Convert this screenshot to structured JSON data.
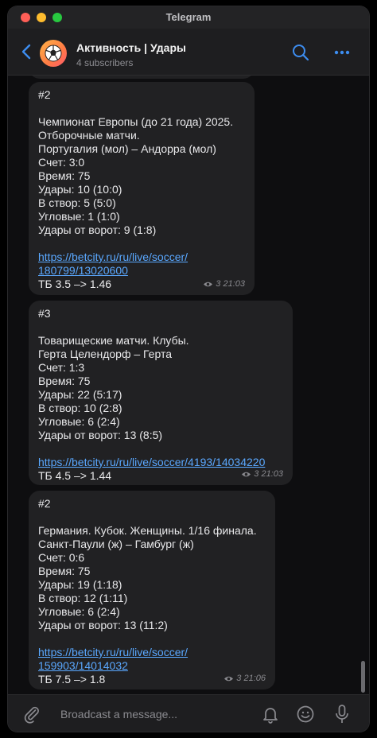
{
  "window": {
    "title": "Telegram"
  },
  "header": {
    "channel_title": "Активность | Удары",
    "subscribers": "4 subscribers",
    "avatar_icon": "soccer-ball-icon"
  },
  "messages": [
    {
      "lines": [
        "#2",
        "",
        "Чемпионат Европы (до 21 года) 2025.",
        "Отборочные матчи.",
        "Португалия (мол) – Андорра (мол)",
        "Счет: 3:0",
        "Время: 75",
        "Удары: 10 (10:0)",
        "В створ: 5 (5:0)",
        "Угловые: 1 (1:0)",
        "Удары от ворот: 9 (1:8)",
        ""
      ],
      "link_lines": [
        "https://betcity.ru/ru/live/soccer/",
        "180799/13020600"
      ],
      "footer": "ТБ 3.5 –> 1.46",
      "time": "3 21:03"
    },
    {
      "lines": [
        "#3",
        "",
        "Товарищеские матчи. Клубы.",
        "Герта Целендорф – Герта",
        "Счет: 1:3",
        "Время: 75",
        "Удары: 22 (5:17)",
        "В створ: 10 (2:8)",
        "Угловые: 6 (2:4)",
        "Удары от ворот: 13 (8:5)",
        ""
      ],
      "link_lines": [
        "https://betcity.ru/ru/live/soccer/4193/14034220"
      ],
      "footer": "ТБ 4.5 –> 1.44",
      "time": "3 21:03"
    },
    {
      "lines": [
        "#2",
        "",
        "Германия. Кубок. Женщины. 1/16 финала.",
        "Санкт-Паули (ж) – Гамбург (ж)",
        "Счет: 0:6",
        "Время: 75",
        "Удары: 19 (1:18)",
        "В створ: 12 (1:11)",
        "Угловые: 6 (2:4)",
        "Удары от ворот: 13 (11:2)",
        ""
      ],
      "link_lines": [
        "https://betcity.ru/ru/live/soccer/",
        "159903/14014032"
      ],
      "footer": "ТБ 7.5 –> 1.8",
      "time": "3 21:06"
    }
  ],
  "composer": {
    "placeholder": "Broadcast a message..."
  },
  "colors": {
    "link": "#5aa8ff",
    "bubble": "#212123",
    "accent": "#3d8df0"
  }
}
